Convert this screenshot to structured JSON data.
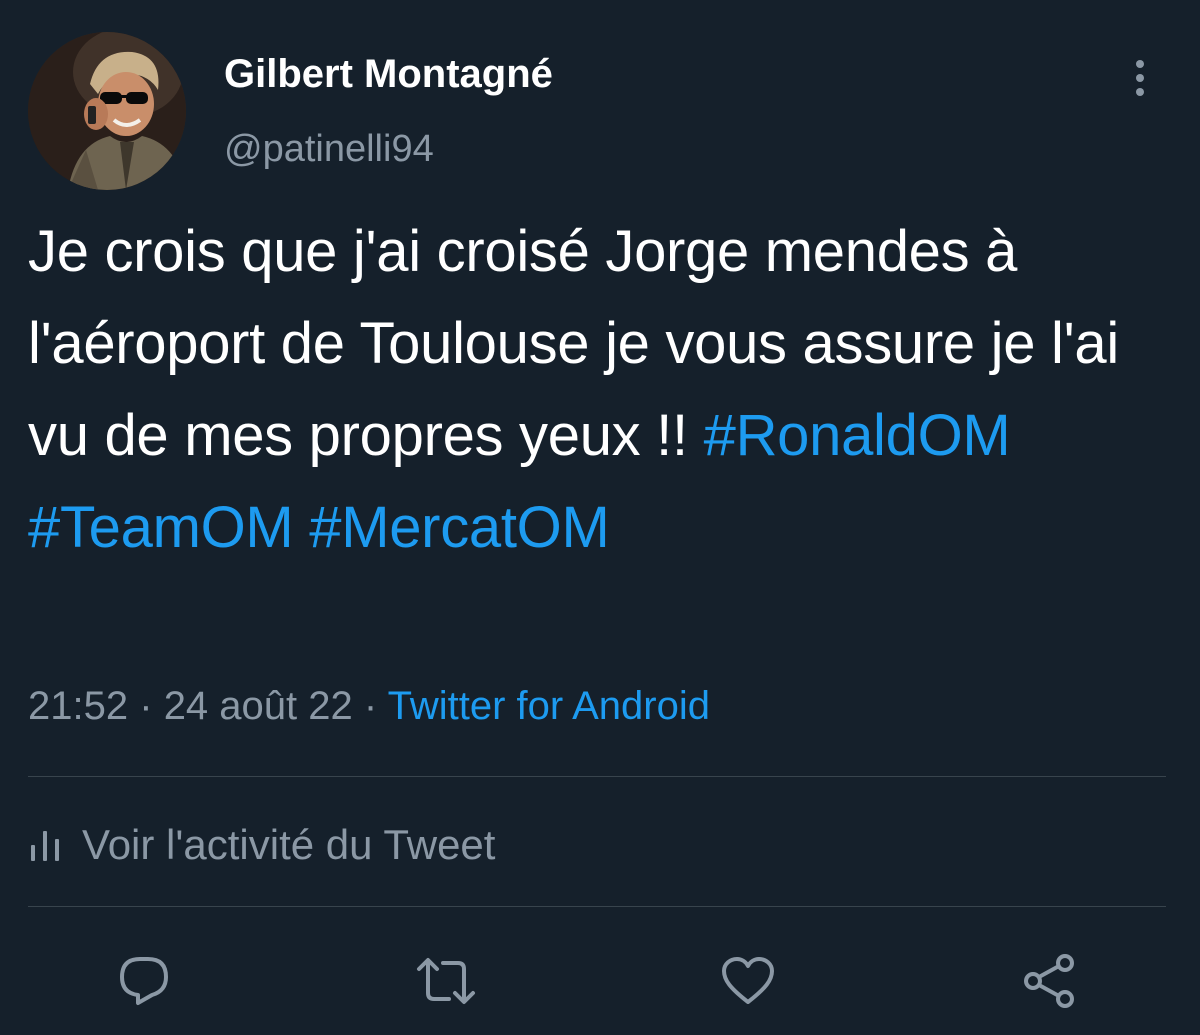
{
  "tweet": {
    "author_name": "Gilbert Montagné",
    "author_handle": "@patinelli94",
    "text_plain": "Je crois que j'ai croisé Jorge mendes à l'aéroport de Toulouse je vous assure je l'ai vu de mes propres yeux !! ",
    "hashtags": [
      "#RonaldOM",
      "#TeamOM",
      "#MercatOM"
    ],
    "time": "21:52",
    "separator": "·",
    "date": "24 août 22",
    "source": "Twitter for Android",
    "activity_label": "Voir l'activité du Tweet"
  },
  "actions": [
    {
      "icon": "reply-icon"
    },
    {
      "icon": "retweet-icon"
    },
    {
      "icon": "like-icon"
    },
    {
      "icon": "share-icon"
    }
  ],
  "colors": {
    "background": "#15202b",
    "text": "#ffffff",
    "secondary": "#8b98a5",
    "accent": "#1d9bf0",
    "divider": "#38444d"
  }
}
